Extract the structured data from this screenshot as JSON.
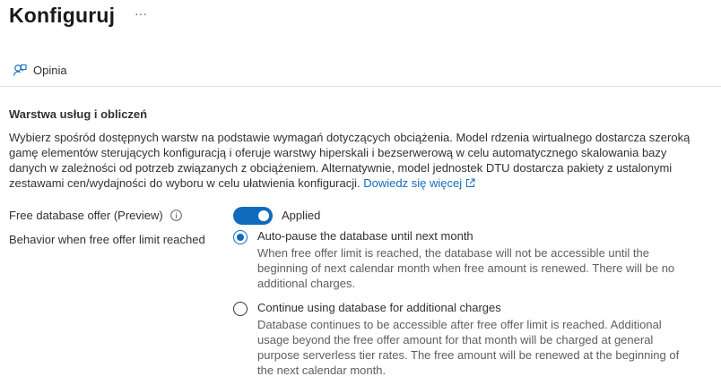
{
  "header": {
    "title": "Konfiguruj",
    "more_label": "···"
  },
  "toolbar": {
    "feedback_label": "Opinia",
    "feedback_icon": "feedback-person-icon"
  },
  "section": {
    "title": "Warstwa usług i obliczeń",
    "description": "Wybierz spośród dostępnych warstw na podstawie wymagań dotyczących obciążenia. Model rdzenia wirtualnego dostarcza szeroką gamę elementów sterujących konfiguracją i oferuje warstwy hiperskali i bezserwerową w celu automatycznego skalowania bazy danych w zależności od potrzeb związanych z obciążeniem. Alternatywnie, model jednostek DTU dostarcza pakiety z ustalonymi zestawami cen/wydajności do wyboru w celu ułatwienia konfiguracji.",
    "learn_more": "Dowiedz się więcej"
  },
  "free_offer": {
    "label": "Free database offer (Preview)",
    "toggle_on": true,
    "toggle_label": "Applied"
  },
  "behavior": {
    "label": "Behavior when free offer limit reached",
    "options": [
      {
        "label": "Auto-pause the database until next month",
        "description": "When free offer limit is reached, the database will not be accessible until the beginning of next calendar month when free amount is renewed. There will be no additional charges.",
        "selected": true
      },
      {
        "label": "Continue using database for additional charges",
        "description": "Database continues to be accessible after free offer limit is reached. Additional usage beyond the free offer amount for that month will be charged at general purpose serverless tier rates. The free amount will be renewed at the beginning of the next calendar month.",
        "selected": false
      }
    ]
  },
  "colors": {
    "accent": "#0f6cbd",
    "text": "#323130",
    "muted_text": "#605e5c"
  }
}
